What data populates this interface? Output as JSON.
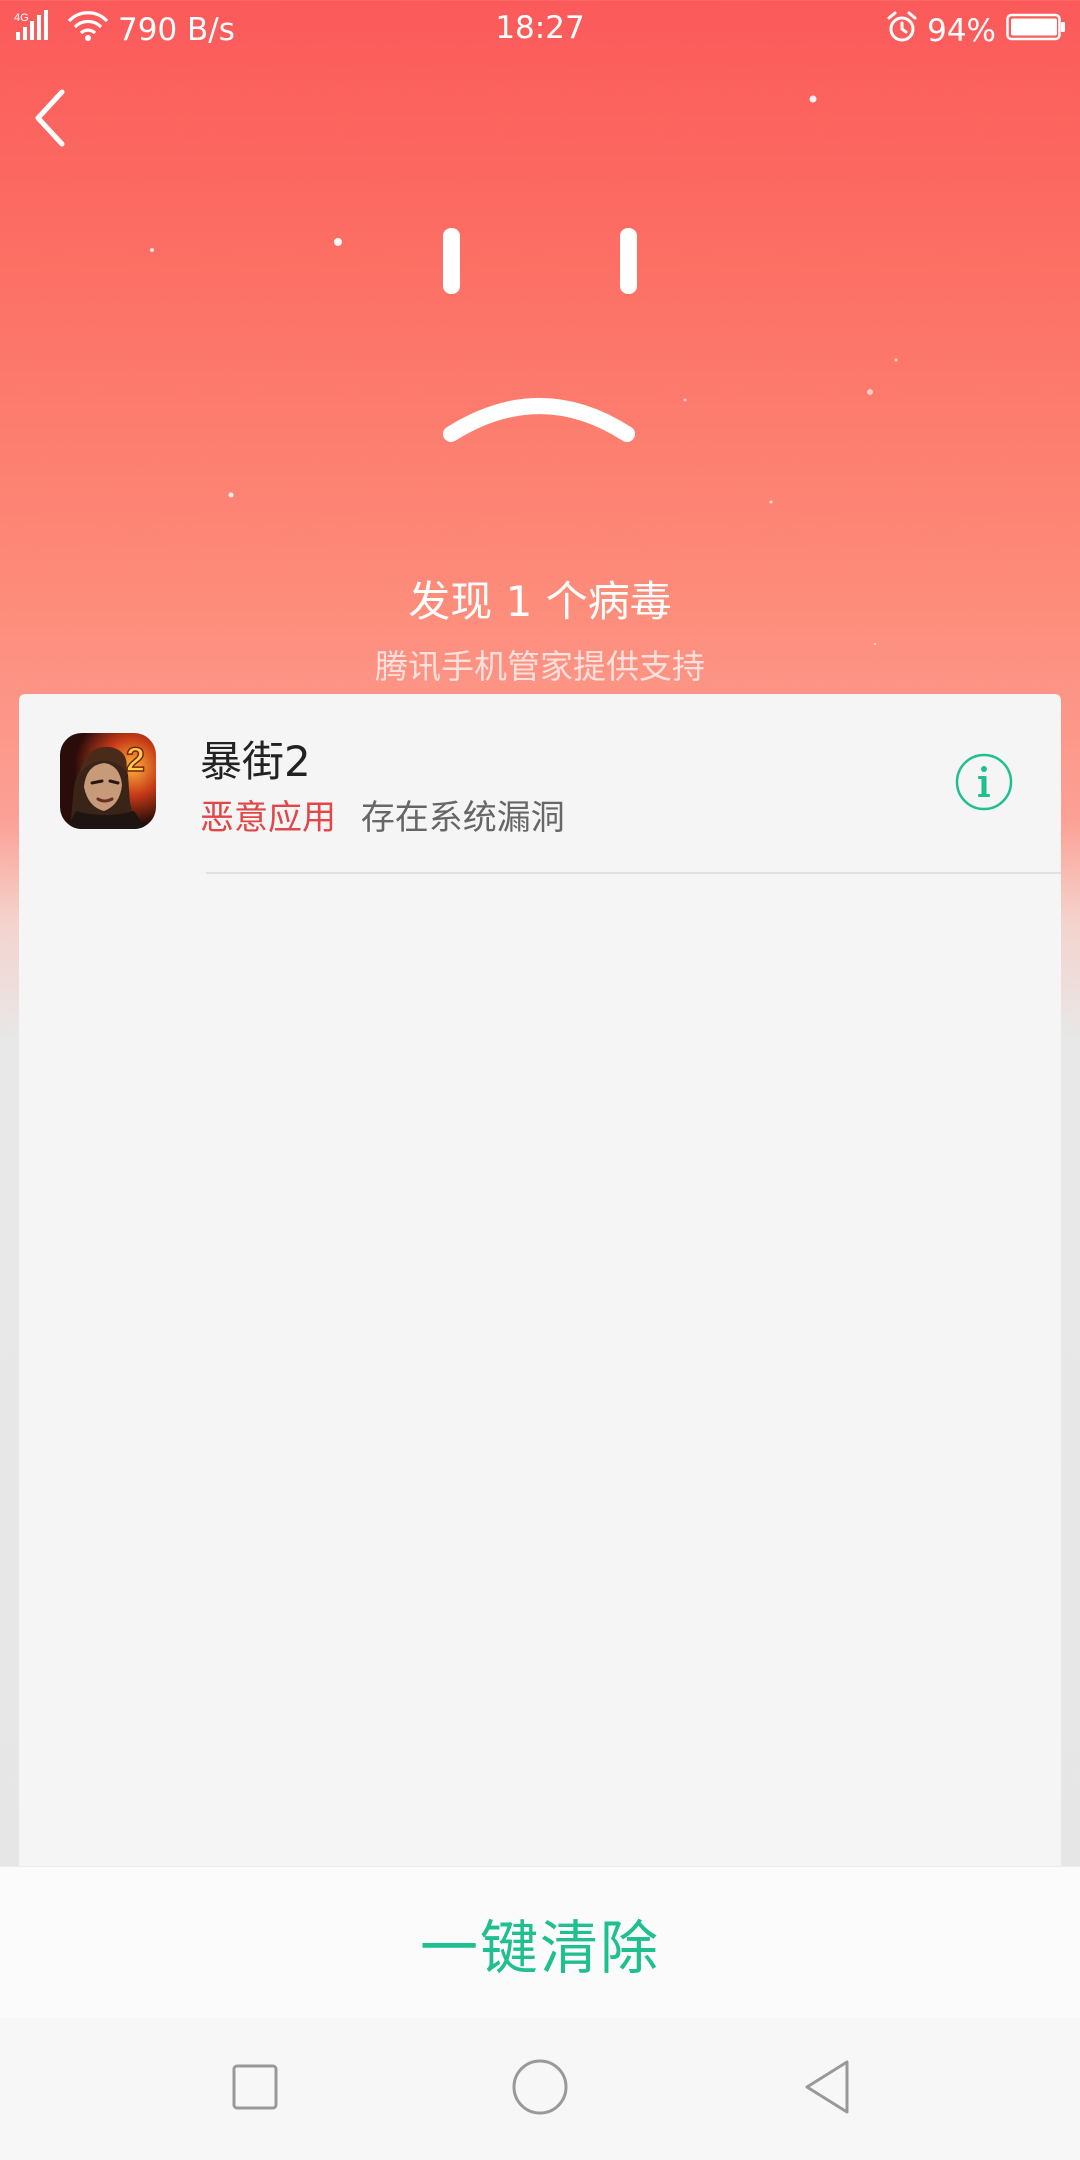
{
  "status_bar": {
    "network": "4G",
    "speed": "790 B/s",
    "time": "18:27",
    "battery": "94%",
    "icons": [
      "signal-icon",
      "wifi-icon",
      "alarm-icon",
      "battery-icon"
    ]
  },
  "header": {
    "back_icon": "back-arrow-icon",
    "face_icon": "sad-face-icon"
  },
  "scan_result": {
    "title": "发现 1 个病毒",
    "subtitle": "腾讯手机管家提供支持"
  },
  "threats": [
    {
      "name": "暴街2",
      "tag": "恶意应用",
      "description": "存在系统漏洞",
      "icon": "app-icon",
      "info_icon": "info-icon"
    }
  ],
  "actions": {
    "clean_label": "一键清除"
  },
  "nav": {
    "icons": [
      "recents-icon",
      "home-icon",
      "back-icon"
    ]
  },
  "colors": {
    "header_top": "#fb5a5a",
    "header_bottom": "#fd8c7a",
    "accent_green": "#1fbf8f",
    "danger_red": "#e24646"
  }
}
